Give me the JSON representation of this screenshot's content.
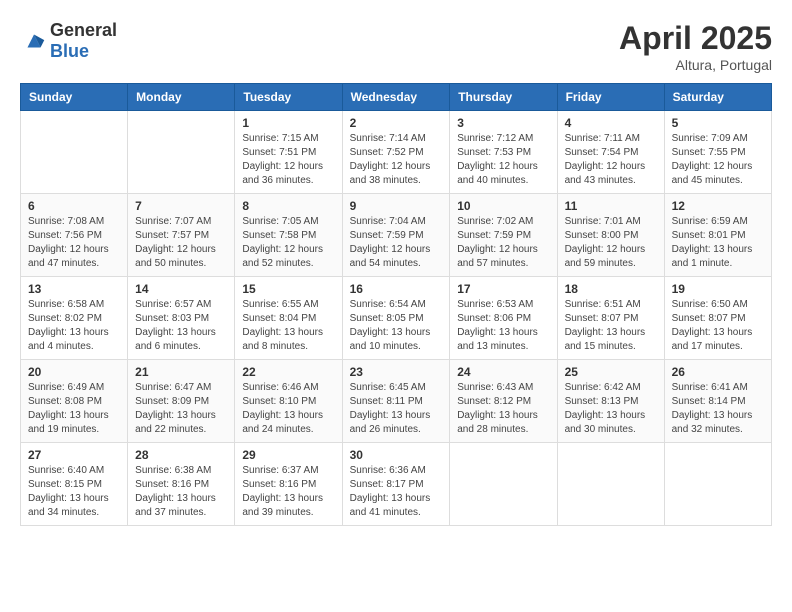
{
  "header": {
    "logo_general": "General",
    "logo_blue": "Blue",
    "month": "April 2025",
    "location": "Altura, Portugal"
  },
  "days_of_week": [
    "Sunday",
    "Monday",
    "Tuesday",
    "Wednesday",
    "Thursday",
    "Friday",
    "Saturday"
  ],
  "weeks": [
    [
      {
        "num": "",
        "sunrise": "",
        "sunset": "",
        "daylight": ""
      },
      {
        "num": "",
        "sunrise": "",
        "sunset": "",
        "daylight": ""
      },
      {
        "num": "1",
        "sunrise": "Sunrise: 7:15 AM",
        "sunset": "Sunset: 7:51 PM",
        "daylight": "Daylight: 12 hours and 36 minutes."
      },
      {
        "num": "2",
        "sunrise": "Sunrise: 7:14 AM",
        "sunset": "Sunset: 7:52 PM",
        "daylight": "Daylight: 12 hours and 38 minutes."
      },
      {
        "num": "3",
        "sunrise": "Sunrise: 7:12 AM",
        "sunset": "Sunset: 7:53 PM",
        "daylight": "Daylight: 12 hours and 40 minutes."
      },
      {
        "num": "4",
        "sunrise": "Sunrise: 7:11 AM",
        "sunset": "Sunset: 7:54 PM",
        "daylight": "Daylight: 12 hours and 43 minutes."
      },
      {
        "num": "5",
        "sunrise": "Sunrise: 7:09 AM",
        "sunset": "Sunset: 7:55 PM",
        "daylight": "Daylight: 12 hours and 45 minutes."
      }
    ],
    [
      {
        "num": "6",
        "sunrise": "Sunrise: 7:08 AM",
        "sunset": "Sunset: 7:56 PM",
        "daylight": "Daylight: 12 hours and 47 minutes."
      },
      {
        "num": "7",
        "sunrise": "Sunrise: 7:07 AM",
        "sunset": "Sunset: 7:57 PM",
        "daylight": "Daylight: 12 hours and 50 minutes."
      },
      {
        "num": "8",
        "sunrise": "Sunrise: 7:05 AM",
        "sunset": "Sunset: 7:58 PM",
        "daylight": "Daylight: 12 hours and 52 minutes."
      },
      {
        "num": "9",
        "sunrise": "Sunrise: 7:04 AM",
        "sunset": "Sunset: 7:59 PM",
        "daylight": "Daylight: 12 hours and 54 minutes."
      },
      {
        "num": "10",
        "sunrise": "Sunrise: 7:02 AM",
        "sunset": "Sunset: 7:59 PM",
        "daylight": "Daylight: 12 hours and 57 minutes."
      },
      {
        "num": "11",
        "sunrise": "Sunrise: 7:01 AM",
        "sunset": "Sunset: 8:00 PM",
        "daylight": "Daylight: 12 hours and 59 minutes."
      },
      {
        "num": "12",
        "sunrise": "Sunrise: 6:59 AM",
        "sunset": "Sunset: 8:01 PM",
        "daylight": "Daylight: 13 hours and 1 minute."
      }
    ],
    [
      {
        "num": "13",
        "sunrise": "Sunrise: 6:58 AM",
        "sunset": "Sunset: 8:02 PM",
        "daylight": "Daylight: 13 hours and 4 minutes."
      },
      {
        "num": "14",
        "sunrise": "Sunrise: 6:57 AM",
        "sunset": "Sunset: 8:03 PM",
        "daylight": "Daylight: 13 hours and 6 minutes."
      },
      {
        "num": "15",
        "sunrise": "Sunrise: 6:55 AM",
        "sunset": "Sunset: 8:04 PM",
        "daylight": "Daylight: 13 hours and 8 minutes."
      },
      {
        "num": "16",
        "sunrise": "Sunrise: 6:54 AM",
        "sunset": "Sunset: 8:05 PM",
        "daylight": "Daylight: 13 hours and 10 minutes."
      },
      {
        "num": "17",
        "sunrise": "Sunrise: 6:53 AM",
        "sunset": "Sunset: 8:06 PM",
        "daylight": "Daylight: 13 hours and 13 minutes."
      },
      {
        "num": "18",
        "sunrise": "Sunrise: 6:51 AM",
        "sunset": "Sunset: 8:07 PM",
        "daylight": "Daylight: 13 hours and 15 minutes."
      },
      {
        "num": "19",
        "sunrise": "Sunrise: 6:50 AM",
        "sunset": "Sunset: 8:07 PM",
        "daylight": "Daylight: 13 hours and 17 minutes."
      }
    ],
    [
      {
        "num": "20",
        "sunrise": "Sunrise: 6:49 AM",
        "sunset": "Sunset: 8:08 PM",
        "daylight": "Daylight: 13 hours and 19 minutes."
      },
      {
        "num": "21",
        "sunrise": "Sunrise: 6:47 AM",
        "sunset": "Sunset: 8:09 PM",
        "daylight": "Daylight: 13 hours and 22 minutes."
      },
      {
        "num": "22",
        "sunrise": "Sunrise: 6:46 AM",
        "sunset": "Sunset: 8:10 PM",
        "daylight": "Daylight: 13 hours and 24 minutes."
      },
      {
        "num": "23",
        "sunrise": "Sunrise: 6:45 AM",
        "sunset": "Sunset: 8:11 PM",
        "daylight": "Daylight: 13 hours and 26 minutes."
      },
      {
        "num": "24",
        "sunrise": "Sunrise: 6:43 AM",
        "sunset": "Sunset: 8:12 PM",
        "daylight": "Daylight: 13 hours and 28 minutes."
      },
      {
        "num": "25",
        "sunrise": "Sunrise: 6:42 AM",
        "sunset": "Sunset: 8:13 PM",
        "daylight": "Daylight: 13 hours and 30 minutes."
      },
      {
        "num": "26",
        "sunrise": "Sunrise: 6:41 AM",
        "sunset": "Sunset: 8:14 PM",
        "daylight": "Daylight: 13 hours and 32 minutes."
      }
    ],
    [
      {
        "num": "27",
        "sunrise": "Sunrise: 6:40 AM",
        "sunset": "Sunset: 8:15 PM",
        "daylight": "Daylight: 13 hours and 34 minutes."
      },
      {
        "num": "28",
        "sunrise": "Sunrise: 6:38 AM",
        "sunset": "Sunset: 8:16 PM",
        "daylight": "Daylight: 13 hours and 37 minutes."
      },
      {
        "num": "29",
        "sunrise": "Sunrise: 6:37 AM",
        "sunset": "Sunset: 8:16 PM",
        "daylight": "Daylight: 13 hours and 39 minutes."
      },
      {
        "num": "30",
        "sunrise": "Sunrise: 6:36 AM",
        "sunset": "Sunset: 8:17 PM",
        "daylight": "Daylight: 13 hours and 41 minutes."
      },
      {
        "num": "",
        "sunrise": "",
        "sunset": "",
        "daylight": ""
      },
      {
        "num": "",
        "sunrise": "",
        "sunset": "",
        "daylight": ""
      },
      {
        "num": "",
        "sunrise": "",
        "sunset": "",
        "daylight": ""
      }
    ]
  ]
}
